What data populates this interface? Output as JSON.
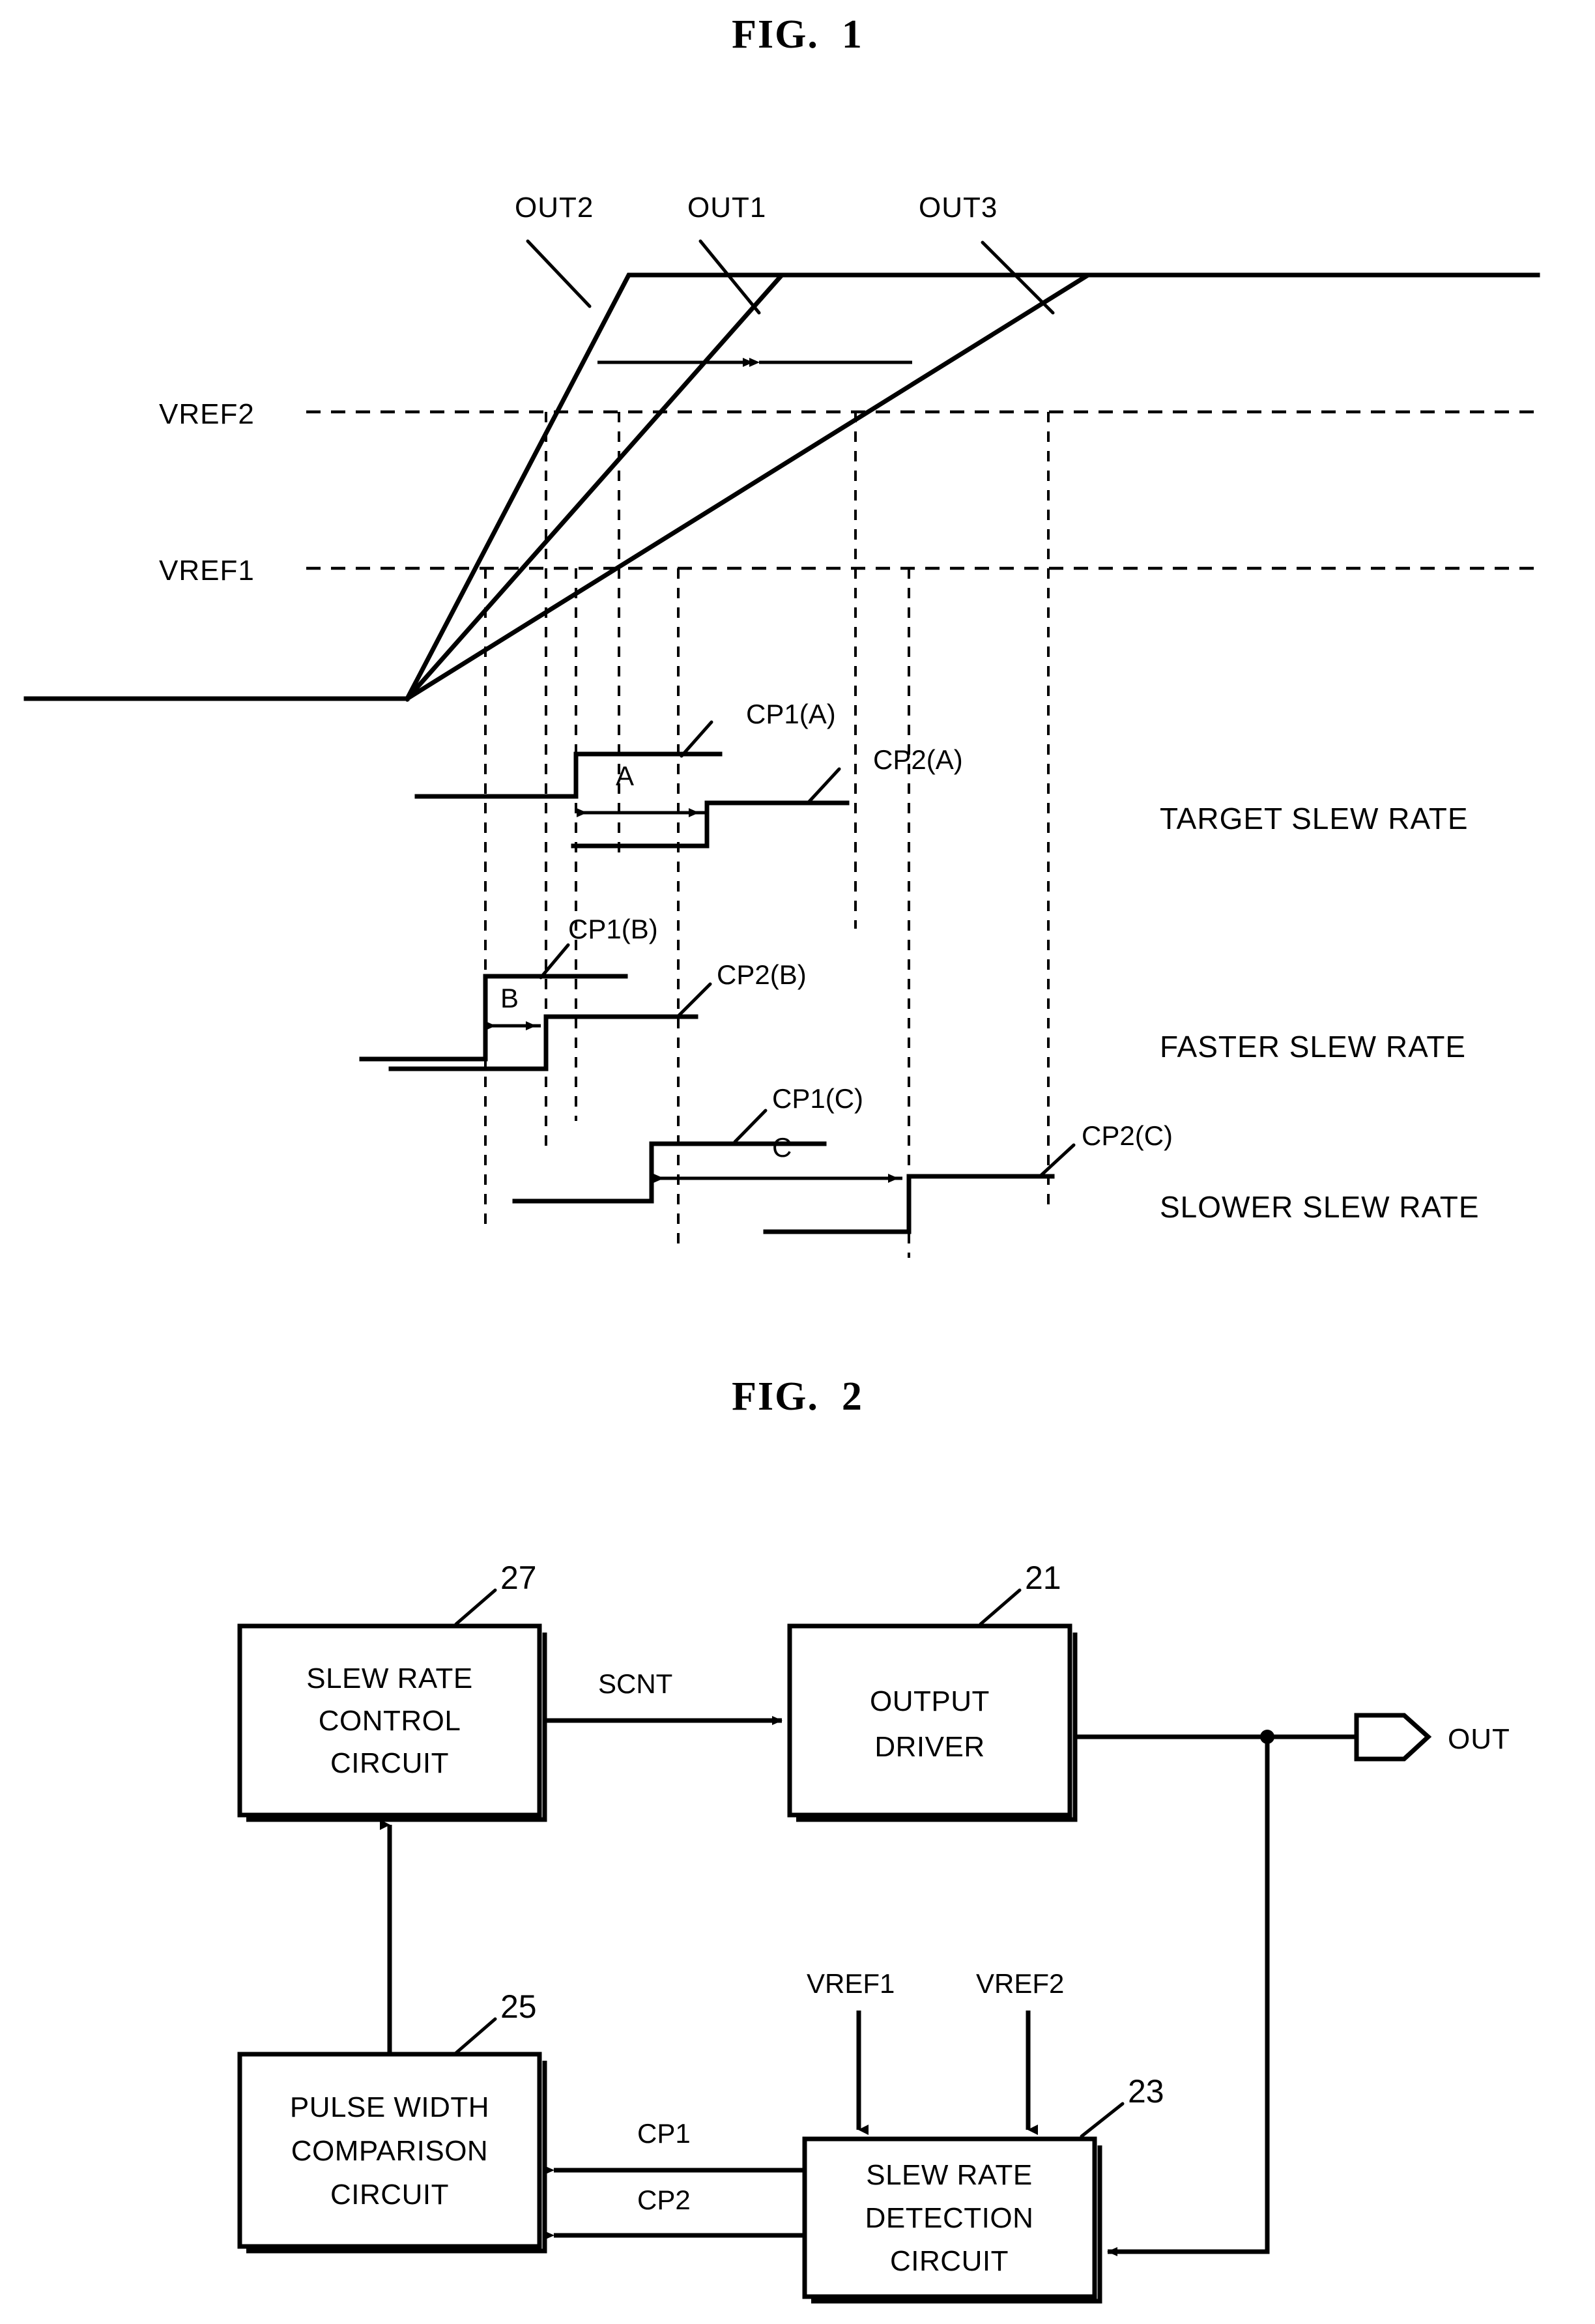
{
  "figures": [
    {
      "id": "fig1",
      "title": "FIG.  1",
      "waveform_labels": [
        "OUT2",
        "OUT1",
        "OUT3"
      ],
      "threshold_labels": [
        "VREF2",
        "VREF1"
      ],
      "pulse_labels": [
        "CP1(A)",
        "CP2(A)",
        "CP1(B)",
        "CP2(B)",
        "CP1(C)",
        "CP2(C)"
      ],
      "interval_labels": [
        "A",
        "B",
        "C"
      ],
      "row_labels": [
        "TARGET SLEW RATE",
        "FASTER SLEW RATE",
        "SLOWER SLEW RATE"
      ]
    },
    {
      "id": "fig2",
      "title": "FIG.  2",
      "blocks": [
        {
          "ref": "27",
          "lines": [
            "SLEW RATE",
            "CONTROL",
            "CIRCUIT"
          ]
        },
        {
          "ref": "21",
          "lines": [
            "OUTPUT",
            "DRIVER"
          ]
        },
        {
          "ref": "25",
          "lines": [
            "PULSE WIDTH",
            "COMPARISON",
            "CIRCUIT"
          ]
        },
        {
          "ref": "23",
          "lines": [
            "SLEW RATE",
            "DETECTION",
            "CIRCUIT"
          ]
        }
      ],
      "signals": [
        "SCNT",
        "CP1",
        "CP2"
      ],
      "inputs": [
        "VREF1",
        "VREF2"
      ],
      "output_pin": "OUT"
    }
  ],
  "fig1": {
    "out2": "OUT2",
    "out1": "OUT1",
    "out3": "OUT3",
    "vref2": "VREF2",
    "vref1": "VREF1",
    "cp1a": "CP1(A)",
    "cp2a": "CP2(A)",
    "cp1b": "CP1(B)",
    "cp2b": "CP2(B)",
    "cp1c": "CP1(C)",
    "cp2c": "CP2(C)",
    "a": "A",
    "b": "B",
    "c": "C",
    "target": "TARGET SLEW RATE",
    "faster": "FASTER SLEW RATE",
    "slower": "SLOWER SLEW RATE",
    "title": "FIG.  1"
  },
  "fig2": {
    "title": "FIG.  2",
    "ref27": "27",
    "ref21": "21",
    "ref25": "25",
    "ref23": "23",
    "b27l1": "SLEW RATE",
    "b27l2": "CONTROL",
    "b27l3": "CIRCUIT",
    "b21l1": "OUTPUT",
    "b21l2": "DRIVER",
    "b25l1": "PULSE WIDTH",
    "b25l2": "COMPARISON",
    "b25l3": "CIRCUIT",
    "b23l1": "SLEW RATE",
    "b23l2": "DETECTION",
    "b23l3": "CIRCUIT",
    "scnt": "SCNT",
    "cp1": "CP1",
    "cp2": "CP2",
    "vref1": "VREF1",
    "vref2": "VREF2",
    "out": "OUT"
  }
}
